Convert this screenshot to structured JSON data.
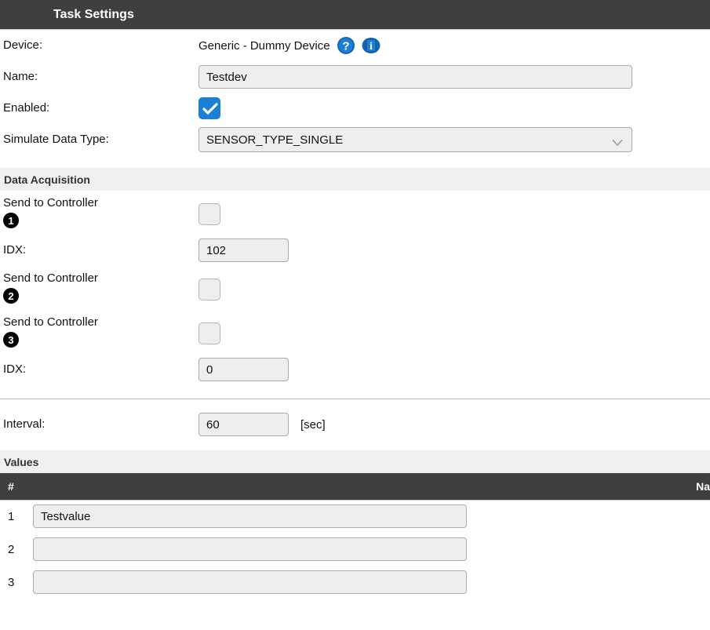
{
  "sections": {
    "task_settings_title": "Task Settings",
    "data_acquisition_title": "Data Acquisition",
    "values_title": "Values"
  },
  "form": {
    "device_label": "Device:",
    "device_value": "Generic - Dummy Device",
    "help_icon": "question-mark-help-icon",
    "info_icon": "information-icon",
    "name_label": "Name:",
    "name_value": "Testdev",
    "name_placeholder": "",
    "enabled_label": "Enabled:",
    "enabled_checked": true,
    "simulate_label": "Simulate Data Type:",
    "simulate_value": "SENSOR_TYPE_SINGLE",
    "simulate_options": [
      "SENSOR_TYPE_SINGLE"
    ],
    "dropdown_icon": "chevron-down-icon"
  },
  "data_acquisition": {
    "controllers": [
      {
        "label": "Send to Controller",
        "badge": "1",
        "checked": false
      },
      {
        "label": "Send to Controller",
        "badge": "2",
        "checked": false
      },
      {
        "label": "Send to Controller",
        "badge": "3",
        "checked": false
      }
    ],
    "idx_label": "IDX:",
    "idx1_value": "102",
    "idx2_value": "0",
    "idx_placeholder": ""
  },
  "interval": {
    "label": "Interval:",
    "value": "60",
    "unit": "[sec]",
    "placeholder": ""
  },
  "values_table": {
    "columns": [
      "#",
      "Na"
    ],
    "rows": [
      {
        "num": "1",
        "name": "Testvalue",
        "placeholder": ""
      },
      {
        "num": "2",
        "name": "",
        "placeholder": ""
      },
      {
        "num": "3",
        "name": "",
        "placeholder": ""
      }
    ]
  },
  "colors": {
    "header_dark": "#3f3f3f",
    "subheader_gray": "#f0f0f0",
    "accent_blue": "#1b7fd4",
    "input_bg": "#eeeeee",
    "badge_black": "#000000"
  }
}
